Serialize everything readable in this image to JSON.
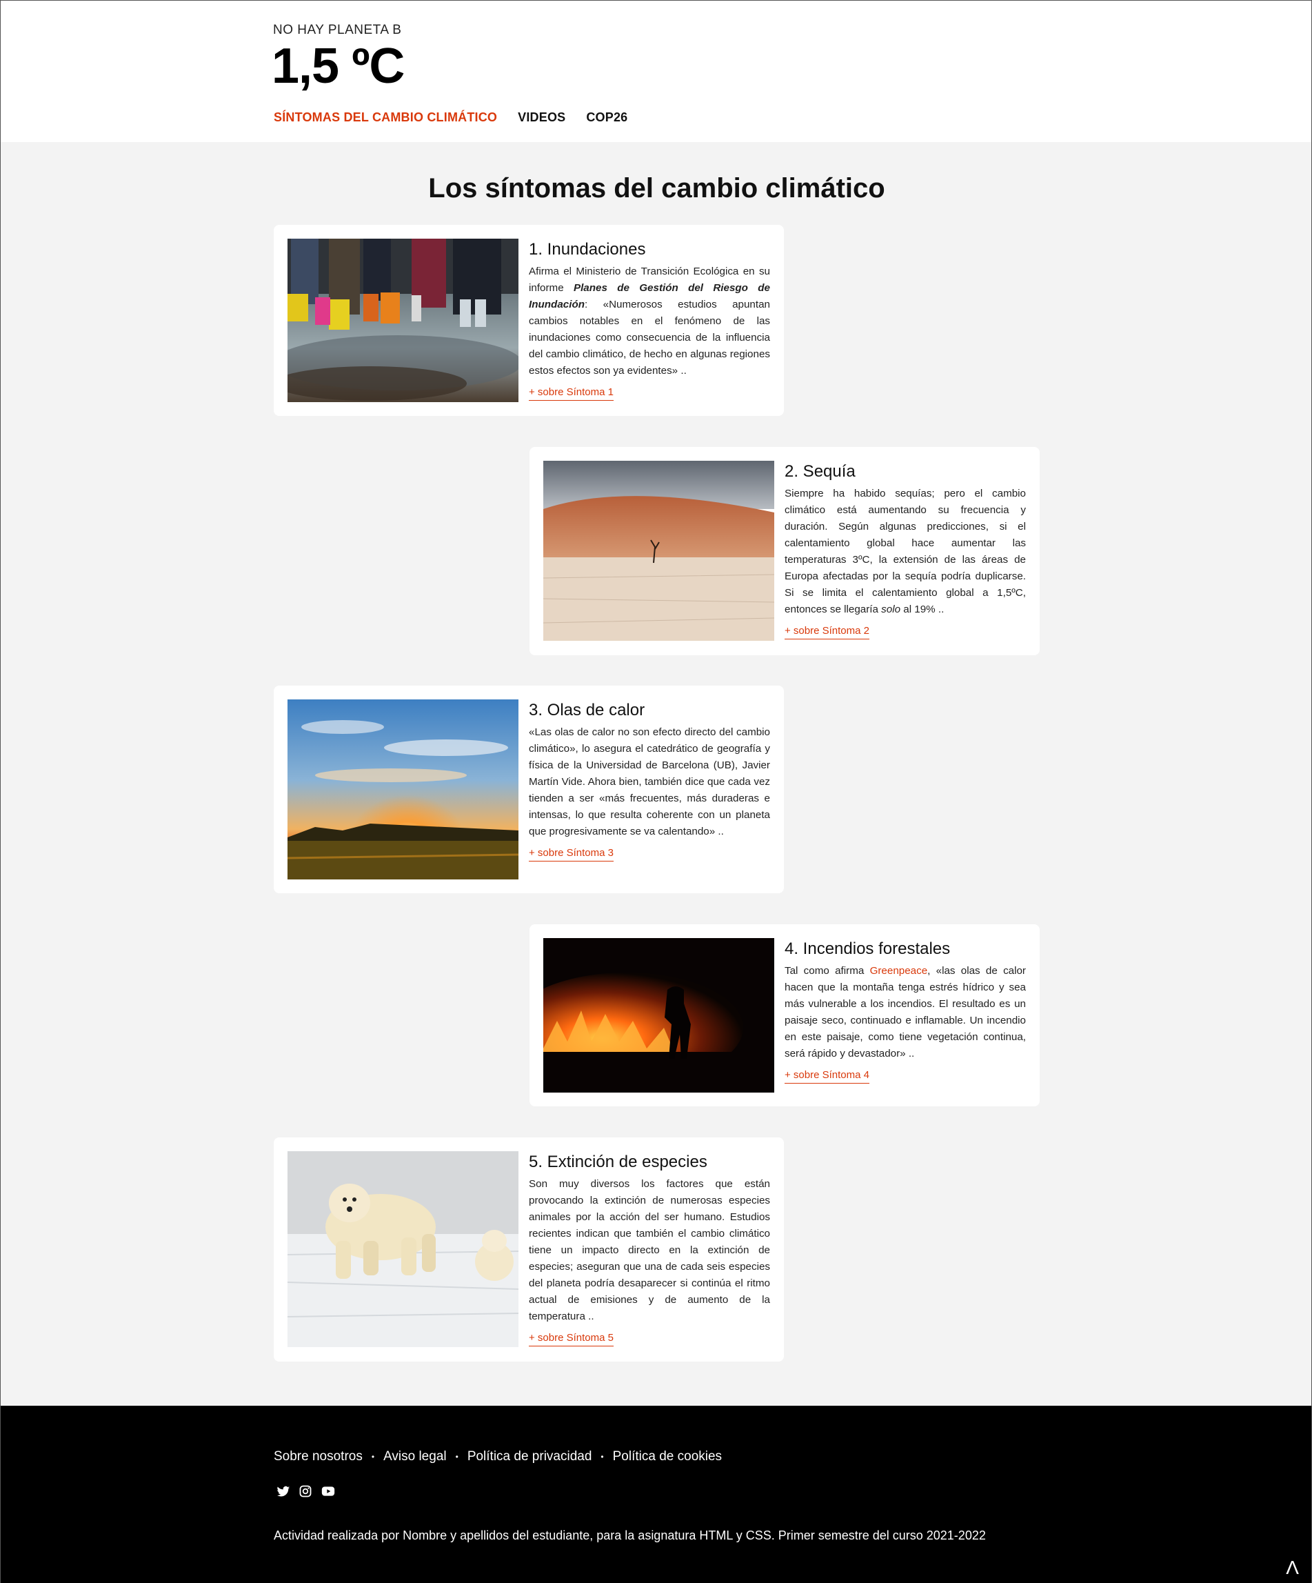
{
  "header": {
    "kicker": "NO HAY PLANETA B",
    "logo": "1,5 ºC",
    "nav": [
      {
        "label": "SÍNTOMAS DEL CAMBIO CLIMÁTICO",
        "active": true
      },
      {
        "label": "VIDEOS",
        "active": false
      },
      {
        "label": "COP26",
        "active": false
      }
    ]
  },
  "page_title": "Los síntomas del cambio climático",
  "cards": [
    {
      "title": "1. Inundaciones",
      "text_before": "Afirma el Ministerio de Transición Ecológica en su informe ",
      "text_em": "Planes de Gestión del Riesgo de Inundación",
      "text_after": ": «Numerosos estudios apuntan cambios notables en el fenómeno de las inundaciones como consecuencia de la influencia del cambio climático, de hecho en algunas regiones estos efectos son ya evidentes» ..",
      "more": "+ sobre Síntoma 1",
      "image": "flood-photo"
    },
    {
      "title": "2. Sequía",
      "text_before": "Siempre ha habido sequías; pero el cambio climático está aumentando su frecuencia y duración. Según algunas predicciones, si el calentamiento global hace aumentar las temperaturas 3ºC, la extensión de las áreas de Europa afectadas por la sequía podría duplicarse. Si se limita el calentamiento global a 1,5ºC, entonces se llegaría ",
      "text_em": "solo",
      "text_after": " al 19% ..",
      "more": "+ sobre Síntoma 2",
      "image": "drought-photo"
    },
    {
      "title": "3. Olas de calor",
      "text_before": "«Las olas de calor no son efecto directo del cambio climático», lo asegura el catedrático de geografía y física de la Universidad de Barcelona (UB), Javier Martín Vide. Ahora bien, también dice que cada vez tienden a ser «más frecuentes, más duraderas e intensas, lo que resulta coherente con un planeta que progresivamente se va calentando» ..",
      "more": "+ sobre Síntoma 3",
      "image": "sunset-photo"
    },
    {
      "title": "4. Incendios forestales",
      "text_before": "Tal como afirma ",
      "link": "Greenpeace",
      "text_after": ", «las olas de calor hacen que la montaña tenga estrés hídrico y sea más vulnerable a los incendios. El resultado es un paisaje seco, continuado e inflamable. Un incendio en este paisaje, como tiene vegetación continua, será rápido y devastador» ..",
      "more": "+ sobre Síntoma 4",
      "image": "wildfire-photo"
    },
    {
      "title": "5. Extinción de especies",
      "text_before": "Son muy diversos los factores que están provocando la extinción de numerosas especies animales por la acción del ser humano. Estudios recientes indican que también el cambio climático tiene un impacto directo en la extinción de especies; aseguran que una de cada seis especies del planeta podría desaparecer si continúa el ritmo actual de emisiones y de aumento de la temperatura ..",
      "more": "+ sobre Síntoma 5",
      "image": "polar-bears-photo"
    }
  ],
  "footer": {
    "links": [
      "Sobre nosotros",
      "Aviso legal",
      "Política de privacidad",
      "Política de cookies"
    ],
    "social": [
      "twitter-icon",
      "instagram-icon",
      "youtube-icon"
    ],
    "credits": "Actividad realizada por Nombre y apellidos del estudiante, para la asignatura HTML y CSS. Primer semestre del curso 2021-2022",
    "to_top": "Λ"
  },
  "colors": {
    "accent": "#d9390b",
    "background": "#f3f3f3",
    "footer": "#000000"
  }
}
